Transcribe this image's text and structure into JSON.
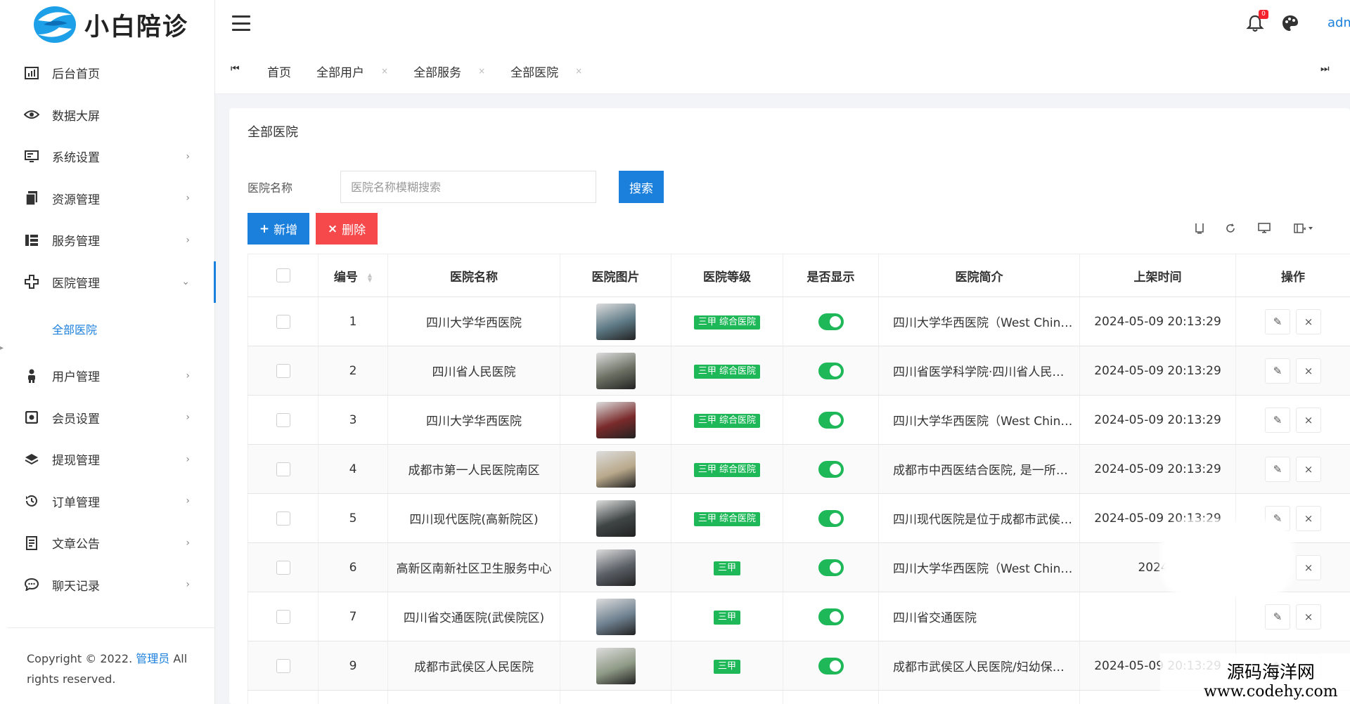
{
  "app": {
    "brand": "小白陪诊",
    "user": "admin",
    "notification_count": "0"
  },
  "sidebar": {
    "items": [
      {
        "label": "后台首页",
        "icon": "dashboard-icon",
        "has_children": false
      },
      {
        "label": "数据大屏",
        "icon": "eye-icon",
        "has_children": false
      },
      {
        "label": "系统设置",
        "icon": "monitor-settings-icon",
        "has_children": true
      },
      {
        "label": "资源管理",
        "icon": "files-icon",
        "has_children": true
      },
      {
        "label": "服务管理",
        "icon": "grid-list-icon",
        "has_children": true
      },
      {
        "label": "医院管理",
        "icon": "medical-cross-icon",
        "has_children": true,
        "expanded": true
      },
      {
        "label": "用户管理",
        "icon": "user-icon",
        "has_children": true
      },
      {
        "label": "会员设置",
        "icon": "member-card-icon",
        "has_children": true
      },
      {
        "label": "提现管理",
        "icon": "layers-icon",
        "has_children": true
      },
      {
        "label": "订单管理",
        "icon": "history-icon",
        "has_children": true
      },
      {
        "label": "文章公告",
        "icon": "document-icon",
        "has_children": true
      },
      {
        "label": "聊天记录",
        "icon": "chat-icon",
        "has_children": true
      }
    ],
    "active_sub": "全部医院",
    "copyright_prefix": "Copyright © 2022.",
    "copyright_link": "管理员",
    "copyright_suffix": "All rights reserved."
  },
  "tabs": [
    {
      "label": "首页",
      "closable": false
    },
    {
      "label": "全部用户",
      "closable": true
    },
    {
      "label": "全部服务",
      "closable": true
    },
    {
      "label": "全部医院",
      "closable": true
    }
  ],
  "page": {
    "title": "全部医院",
    "filter_label": "医院名称",
    "search_placeholder": "医院名称模糊搜索",
    "search_button": "搜索",
    "add_button": "新增",
    "delete_button": "删除"
  },
  "table": {
    "headers": [
      "编号",
      "医院名称",
      "医院图片",
      "医院等级",
      "是否显示",
      "医院简介",
      "上架时间",
      "操作"
    ],
    "rows": [
      {
        "id": "1",
        "name": "四川大学华西医院",
        "level": "三甲 综合医院",
        "visible": true,
        "intro": "四川大学华西医院（West China Hospi...",
        "time": "2024-05-09 20:13:29",
        "thumb": "#5e7a86"
      },
      {
        "id": "2",
        "name": "四川省人民医院",
        "level": "三甲 综合医院",
        "visible": true,
        "intro": "四川省医学科学院·四川省人民医院，位...",
        "time": "2024-05-09 20:13:29",
        "thumb": "#6b6f62"
      },
      {
        "id": "3",
        "name": "四川大学华西医院",
        "level": "三甲 综合医院",
        "visible": true,
        "intro": "四川大学华西医院（West China Hospi...",
        "time": "2024-05-09 20:13:29",
        "thumb": "#7a2a2a"
      },
      {
        "id": "4",
        "name": "成都市第一人民医院南区",
        "level": "三甲 综合医院",
        "visible": true,
        "intro": "成都市中西医结合医院, 是一所集医疗、...",
        "time": "2024-05-09 20:13:29",
        "thumb": "#b9a98c"
      },
      {
        "id": "5",
        "name": "四川现代医院(高新院区)",
        "level": "三甲 综合医院",
        "visible": true,
        "intro": "四川现代医院是位于成都市武侯区武兴...",
        "time": "2024-05-09 20:13:29",
        "thumb": "#3f4545"
      },
      {
        "id": "6",
        "name": "高新区南新社区卫生服务中心",
        "level": "三甲",
        "visible": true,
        "intro": "四川大学华西医院（West China Hospi...",
        "time": "2024-(",
        "thumb": "#5a5f66"
      },
      {
        "id": "7",
        "name": "四川省交通医院(武侯院区)",
        "level": "三甲",
        "visible": true,
        "intro": "四川省交通医院",
        "time": "",
        "thumb": "#6f8190"
      },
      {
        "id": "9",
        "name": "成都市武侯区人民医院",
        "level": "三甲",
        "visible": true,
        "intro": "成都市武侯区人民医院/妇幼保健院位于...",
        "time": "2024-05-09 20:13:29",
        "thumb": "#8f9a86"
      }
    ]
  },
  "watermark": {
    "line1": "源码海洋网",
    "line2": "www.codehy.com"
  },
  "colors": {
    "primary": "#1b7fdc",
    "danger": "#f5494b",
    "success": "#1fb859"
  }
}
